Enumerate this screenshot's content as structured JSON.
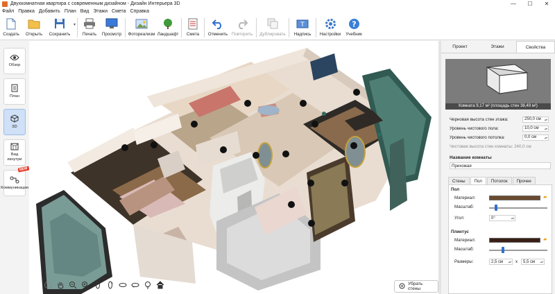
{
  "window": {
    "title": "Двухкомнатная квартира с современным дизайном - Дизайн Интерьера 3D",
    "controls": [
      "—",
      "☐",
      "✕"
    ]
  },
  "menu": [
    "Файл",
    "Правка",
    "Добавить",
    "План",
    "Вид",
    "Этажи",
    "Смета",
    "Справка"
  ],
  "toolbar": {
    "create": "Создать",
    "open": "Открыть",
    "save": "Сохранить",
    "print": "Печать",
    "preview": "Просмотр",
    "photorealism": "Фотореализм",
    "landscape": "Ландшафт",
    "estimate": "Смета",
    "undo": "Отменить",
    "redo": "Повторить",
    "duplicate": "Дублировать",
    "caption": "Надпись",
    "settings": "Настройки",
    "tutorial": "Учебник"
  },
  "left_panel": {
    "overview": "Обзор",
    "plan": "План",
    "view3d": "3D",
    "inside_view": "Вид изнутри",
    "communications": "Коммуникации",
    "new_badge": "NEW"
  },
  "viewport": {
    "remove_walls": "Убрать стены"
  },
  "right_panel": {
    "tabs": [
      "Проект",
      "Этажи",
      "Свойства"
    ],
    "active_tab": "Свойства",
    "room_caption": "Комната 9,17 м² (площадь стен 38,49 м²)",
    "props": {
      "rough_height_label": "Черновая высота стен этажа:",
      "rough_height_value": "250,0 см",
      "clean_floor_label": "Уровень чистового пола:",
      "clean_floor_value": "10,0 см",
      "clean_ceiling_label": "Уровень чистового потолка:",
      "clean_ceiling_value": "0,0 см",
      "clean_height_label": "Чистовая высота стен комнаты: 240,0 см"
    },
    "room_name_title": "Название комнаты",
    "room_name_value": "Прихожая",
    "sub_tabs": [
      "Стены",
      "Пол",
      "Потолок",
      "Прочее"
    ],
    "active_sub_tab": "Пол",
    "floor": {
      "section": "Пол",
      "material_label": "Материал:",
      "scale_label": "Масштаб:",
      "angle_label": "Угол:",
      "angle_value": "0°",
      "material_color": "#6b4a2e"
    },
    "plinth": {
      "section": "Плинтус",
      "material_label": "Материал:",
      "scale_label": "Масштаб:",
      "sizes_label": "Размеры:",
      "size_a": "2,5 см",
      "size_x": "x",
      "size_b": "5,5 см",
      "material_color": "#3a1f16"
    }
  }
}
